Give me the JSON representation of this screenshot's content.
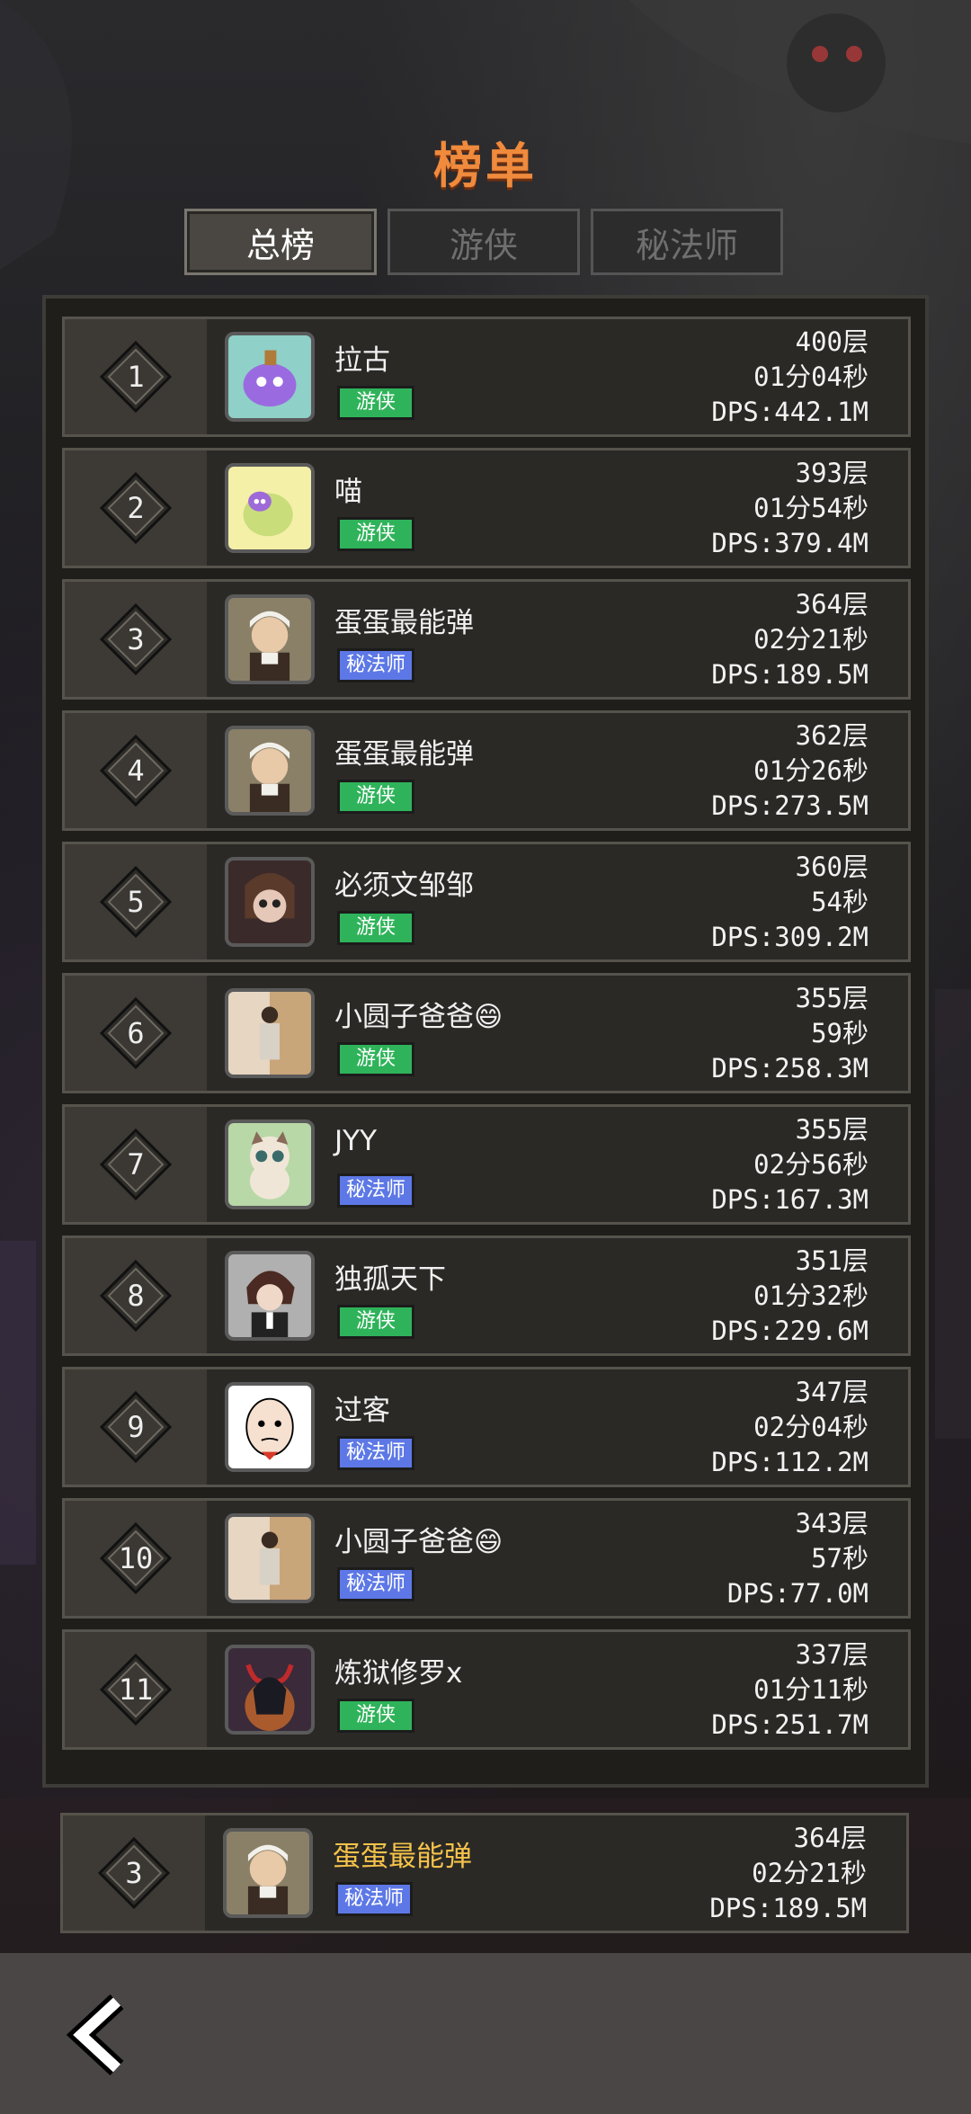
{
  "title": "榜单",
  "tabs": [
    {
      "label": "总榜",
      "active": true
    },
    {
      "label": "游侠",
      "active": false
    },
    {
      "label": "秘法师",
      "active": false
    }
  ],
  "classes": {
    "ranger": {
      "label": "游侠",
      "color": "#2fb35a"
    },
    "mage": {
      "label": "秘法师",
      "color": "#5d78e6"
    }
  },
  "entries": [
    {
      "rank": "1",
      "name": "拉古",
      "class_label": "游侠",
      "class": "ranger",
      "floor": "400层",
      "time": "01分04秒",
      "dps": "DPS:442.1M",
      "avatar": "purple-slime-avatar"
    },
    {
      "rank": "2",
      "name": "喵",
      "class_label": "游侠",
      "class": "ranger",
      "floor": "393层",
      "time": "01分54秒",
      "dps": "DPS:379.4M",
      "avatar": "yellow-slime-avatar"
    },
    {
      "rank": "3",
      "name": "蛋蛋最能弹",
      "class_label": "秘法师",
      "class": "mage",
      "floor": "364层",
      "time": "02分21秒",
      "dps": "DPS:189.5M",
      "avatar": "baby-photo-avatar"
    },
    {
      "rank": "4",
      "name": "蛋蛋最能弹",
      "class_label": "游侠",
      "class": "ranger",
      "floor": "362层",
      "time": "01分26秒",
      "dps": "DPS:273.5M",
      "avatar": "baby-photo-avatar"
    },
    {
      "rank": "5",
      "name": "必须文邹邹",
      "class_label": "游侠",
      "class": "ranger",
      "floor": "360层",
      "time": "54秒",
      "dps": "DPS:309.2M",
      "avatar": "doll-avatar"
    },
    {
      "rank": "6",
      "name": "小圆子爸爸😄",
      "class_label": "游侠",
      "class": "ranger",
      "floor": "355层",
      "time": "59秒",
      "dps": "DPS:258.3M",
      "avatar": "child-photo-avatar"
    },
    {
      "rank": "7",
      "name": "JYY",
      "class_label": "秘法师",
      "class": "mage",
      "floor": "355层",
      "time": "02分56秒",
      "dps": "DPS:167.3M",
      "avatar": "cat-avatar"
    },
    {
      "rank": "8",
      "name": "独孤天下",
      "class_label": "游侠",
      "class": "ranger",
      "floor": "351层",
      "time": "01分32秒",
      "dps": "DPS:229.6M",
      "avatar": "anime-boy-avatar"
    },
    {
      "rank": "9",
      "name": "过客",
      "class_label": "秘法师",
      "class": "mage",
      "floor": "347层",
      "time": "02分04秒",
      "dps": "DPS:112.2M",
      "avatar": "cartoon-face-avatar"
    },
    {
      "rank": "10",
      "name": "小圆子爸爸😄",
      "class_label": "秘法师",
      "class": "mage",
      "floor": "343层",
      "time": "57秒",
      "dps": "DPS:77.0M",
      "avatar": "child-photo-avatar"
    },
    {
      "rank": "11",
      "name": "炼狱修罗x",
      "class_label": "游侠",
      "class": "ranger",
      "floor": "337层",
      "time": "01分11秒",
      "dps": "DPS:251.7M",
      "avatar": "demon-avatar"
    }
  ],
  "my_entry": {
    "rank": "3",
    "name": "蛋蛋最能弹",
    "class_label": "秘法师",
    "class": "mage",
    "floor": "364层",
    "time": "02分21秒",
    "dps": "DPS:189.5M",
    "avatar": "baby-photo-avatar"
  },
  "back_icon": "chevron-left-icon"
}
